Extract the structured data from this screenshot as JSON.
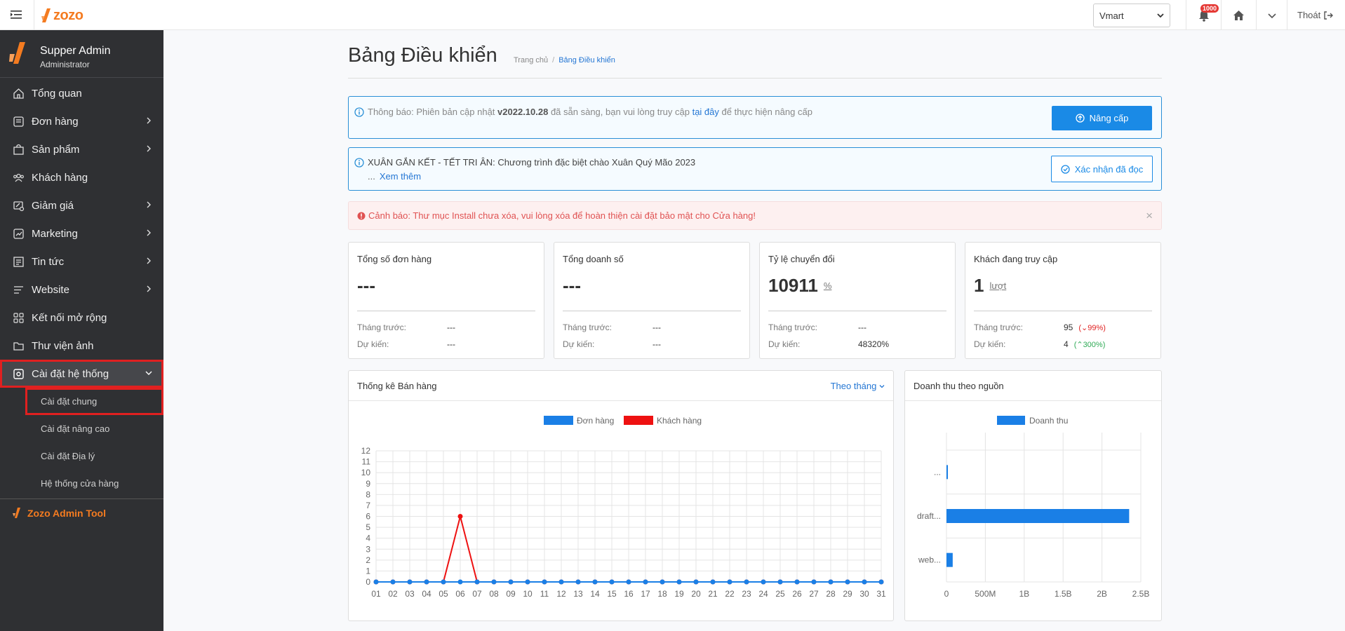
{
  "topbar": {
    "logo_text": "zozo",
    "store_select": "Vmart",
    "notif_count": "1000",
    "logout": "Thoát"
  },
  "sidebar": {
    "user_name": "Supper Admin",
    "user_role": "Administrator",
    "items": [
      {
        "label": "Tổng quan",
        "icon": "home-icon",
        "chevron": false
      },
      {
        "label": "Đơn hàng",
        "icon": "orders-icon",
        "chevron": true
      },
      {
        "label": "Sản phẩm",
        "icon": "bag-icon",
        "chevron": true
      },
      {
        "label": "Khách hàng",
        "icon": "users-icon",
        "chevron": false
      },
      {
        "label": "Giảm giá",
        "icon": "discount-icon",
        "chevron": true
      },
      {
        "label": "Marketing",
        "icon": "marketing-icon",
        "chevron": true
      },
      {
        "label": "Tin tức",
        "icon": "news-icon",
        "chevron": true
      },
      {
        "label": "Website",
        "icon": "website-icon",
        "chevron": true
      },
      {
        "label": "Kết nối mở rộng",
        "icon": "apps-icon",
        "chevron": false
      },
      {
        "label": "Thư viện ảnh",
        "icon": "folder-icon",
        "chevron": false
      },
      {
        "label": "Cài đặt hệ thống",
        "icon": "settings-icon",
        "chevron": true
      }
    ],
    "subitems": [
      "Cài đặt chung",
      "Cài đặt nâng cao",
      "Cài đặt Địa lý",
      "Hệ thống cửa hàng"
    ],
    "tool_link": "Zozo Admin Tool"
  },
  "page": {
    "title": "Bảng Điều khiển",
    "crumb_home": "Trang chủ",
    "crumb_sep": "/",
    "crumb_current": "Bảng Điều khiển"
  },
  "notice_update": {
    "prefix": "Thông báo: Phiên bản cập nhật ",
    "version": "v2022.10.28",
    "middle": " đã sẵn sàng, bạn vui lòng truy cập ",
    "link": "tại đây",
    "suffix": " để thực hiện nâng cấp",
    "button": "Nâng cấp"
  },
  "notice_promo": {
    "title": "XUÂN GẮN KẾT - TẾT TRI ÂN: Chương trình đặc biệt chào Xuân Quý Mão 2023",
    "ellipsis": "...",
    "more": "Xem thêm",
    "button": "Xác nhận đã đọc"
  },
  "warning": {
    "text": "Cảnh báo: Thư mục Install chưa xóa, vui lòng xóa để hoàn thiện cài đặt bảo mật cho Cửa hàng!",
    "close": "×"
  },
  "stats": [
    {
      "title": "Tổng số đơn hàng",
      "value": "---",
      "unit": "",
      "prev_label": "Tháng trước:",
      "prev": "---",
      "prev_change": "",
      "est_label": "Dự kiến:",
      "est": "---",
      "est_change": ""
    },
    {
      "title": "Tổng doanh số",
      "value": "---",
      "unit": "",
      "prev_label": "Tháng trước:",
      "prev": "---",
      "prev_change": "",
      "est_label": "Dự kiến:",
      "est": "---",
      "est_change": ""
    },
    {
      "title": "Tỷ lệ chuyển đổi",
      "value": "10911",
      "unit": "%",
      "prev_label": "Tháng trước:",
      "prev": "---",
      "prev_change": "",
      "est_label": "Dự kiến:",
      "est": "48320%",
      "est_change": ""
    },
    {
      "title": "Khách đang truy cập",
      "value": "1",
      "unit": "lượt",
      "prev_label": "Tháng trước:",
      "prev": "95",
      "prev_change": "(⌄99%)",
      "est_label": "Dự kiến:",
      "est": "4",
      "est_change": "(⌃300%)"
    }
  ],
  "sales_card": {
    "title": "Thống kê Bán hàng",
    "filter": "Theo tháng"
  },
  "revenue_card": {
    "title": "Doanh thu theo nguồn"
  },
  "chart_data": [
    {
      "type": "line",
      "x": [
        "01",
        "02",
        "03",
        "04",
        "05",
        "06",
        "07",
        "08",
        "09",
        "10",
        "11",
        "12",
        "13",
        "14",
        "15",
        "16",
        "17",
        "18",
        "19",
        "20",
        "21",
        "22",
        "23",
        "24",
        "25",
        "26",
        "27",
        "28",
        "29",
        "30",
        "31"
      ],
      "series": [
        {
          "name": "Đơn hàng",
          "color": "#1a7fe6",
          "values": [
            0,
            0,
            0,
            0,
            0,
            0,
            0,
            0,
            0,
            0,
            0,
            0,
            0,
            0,
            0,
            0,
            0,
            0,
            0,
            0,
            0,
            0,
            0,
            0,
            0,
            0,
            0,
            0,
            0,
            0,
            0
          ]
        },
        {
          "name": "Khách hàng",
          "color": "#ee1111",
          "values": [
            0,
            0,
            0,
            0,
            0,
            6,
            0,
            0,
            0,
            0,
            0,
            0,
            0,
            0,
            0,
            0,
            0,
            0,
            0,
            0,
            0,
            0,
            0,
            0,
            0,
            0,
            0,
            0,
            0,
            0,
            0
          ]
        }
      ],
      "yticks": [
        "0",
        "1",
        "2",
        "3",
        "4",
        "5",
        "6",
        "7",
        "8",
        "9",
        "10",
        "11",
        "12"
      ],
      "ylim": [
        0,
        12
      ],
      "legend": "top",
      "grid": true
    },
    {
      "type": "bar",
      "orientation": "horizontal",
      "categories": [
        "...",
        "draft...",
        "web..."
      ],
      "series": [
        {
          "name": "Doanh thu",
          "color": "#1a7fe6",
          "values": [
            10000000,
            2350000000,
            80000000
          ]
        }
      ],
      "xticks": [
        "0",
        "500M",
        "1B",
        "1.5B",
        "2B",
        "2.5B"
      ],
      "xlim": [
        0,
        2500000000
      ],
      "legend": "top",
      "grid": true
    }
  ]
}
